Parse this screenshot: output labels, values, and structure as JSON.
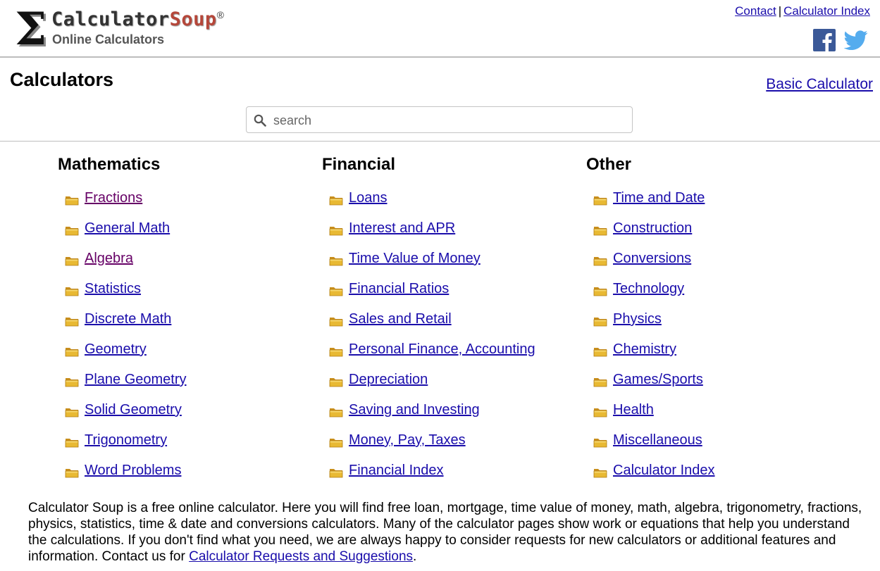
{
  "header": {
    "logo": {
      "title_part1": "Calculator",
      "title_part2": "Soup",
      "registered": "®",
      "subtitle": "Online Calculators"
    },
    "links": {
      "contact": "Contact",
      "separator": "|",
      "calculator_index": "Calculator Index"
    },
    "social": [
      {
        "icon": "facebook-icon",
        "color": "#3b5998"
      },
      {
        "icon": "twitter-icon",
        "color": "#55acee"
      }
    ]
  },
  "page": {
    "title": "Calculators",
    "basic_calculator_link": "Basic Calculator"
  },
  "search": {
    "placeholder": "search",
    "value": ""
  },
  "categories": [
    {
      "heading": "Mathematics",
      "items": [
        "Fractions",
        "General Math",
        "Algebra",
        "Statistics",
        "Discrete Math",
        "Geometry",
        "Plane Geometry",
        "Solid Geometry",
        "Trigonometry",
        "Word Problems"
      ],
      "visited": [
        "Fractions",
        "Algebra"
      ]
    },
    {
      "heading": "Financial",
      "items": [
        "Loans",
        "Interest and APR",
        "Time Value of Money",
        "Financial Ratios",
        "Sales and Retail",
        "Personal Finance, Accounting",
        "Depreciation",
        "Saving and Investing",
        "Money, Pay, Taxes",
        "Financial Index"
      ],
      "visited": []
    },
    {
      "heading": "Other",
      "items": [
        "Time and Date",
        "Construction",
        "Conversions",
        "Technology",
        "Physics",
        "Chemistry",
        "Games/Sports",
        "Health",
        "Miscellaneous",
        "Calculator Index"
      ],
      "visited": []
    }
  ],
  "footer": {
    "text": "Calculator Soup is a free online calculator. Here you will find free loan, mortgage, time value of money, math, algebra, trigonometry, fractions, physics, statistics, time & date and conversions calculators. Many of the calculator pages show work or equations that help you understand the calculations. If you don't find what you need, we are always happy to consider requests for new calculators or additional features and information. Contact us for ",
    "link": "Calculator Requests and Suggestions",
    "end": "."
  },
  "colors": {
    "link": "#1a0dab",
    "visited_link": "#660066",
    "brand_soup": "#b5473a",
    "folder": "#e8b933"
  }
}
